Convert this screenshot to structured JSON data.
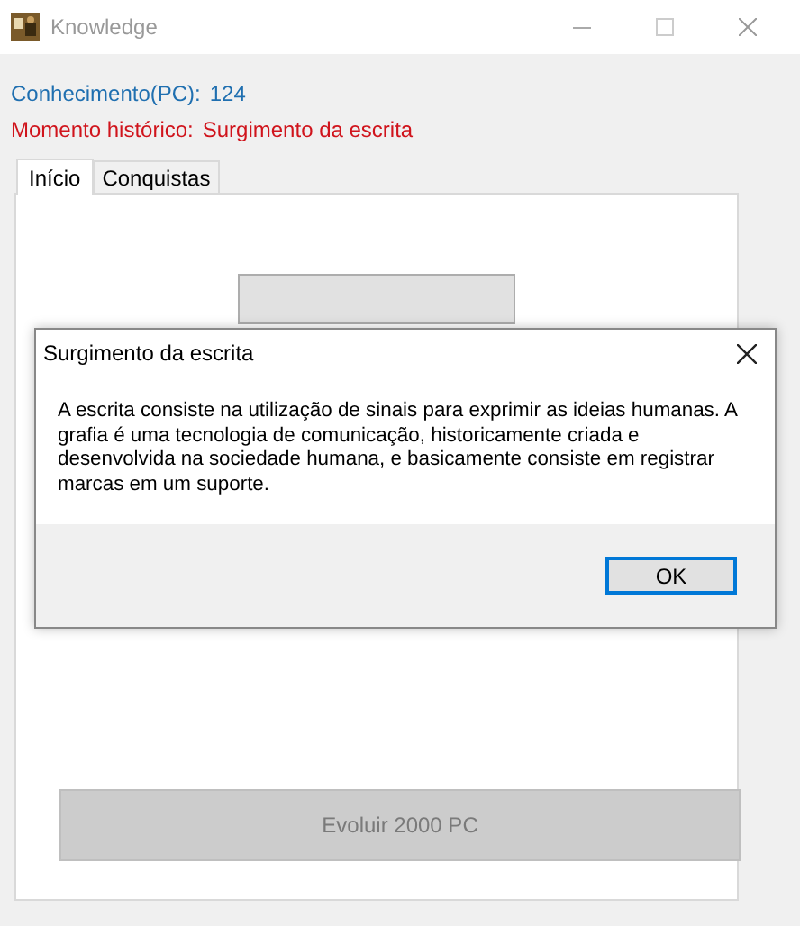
{
  "window": {
    "title": "Knowledge"
  },
  "stats": [
    {
      "kind": "knowledge",
      "label": "Conhecimento(PC):",
      "value": "124"
    },
    {
      "kind": "era",
      "label": "Momento histórico:",
      "value": "Surgimento da escrita"
    }
  ],
  "tabs": [
    {
      "label": "Início",
      "selected": true
    },
    {
      "label": "Conquistas",
      "selected": false
    }
  ],
  "evolve_button": {
    "label": "Evoluir 2000 PC",
    "disabled": true
  },
  "dialog": {
    "title": "Surgimento da escrita",
    "message": "A escrita consiste na utilização de sinais para exprimir as ideias humanas. A grafia é uma tecnologia de comunicação, historicamente criada e desenvolvida na sociedade humana, e basicamente consiste em registrar marcas em um suporte.",
    "button": "OK"
  }
}
